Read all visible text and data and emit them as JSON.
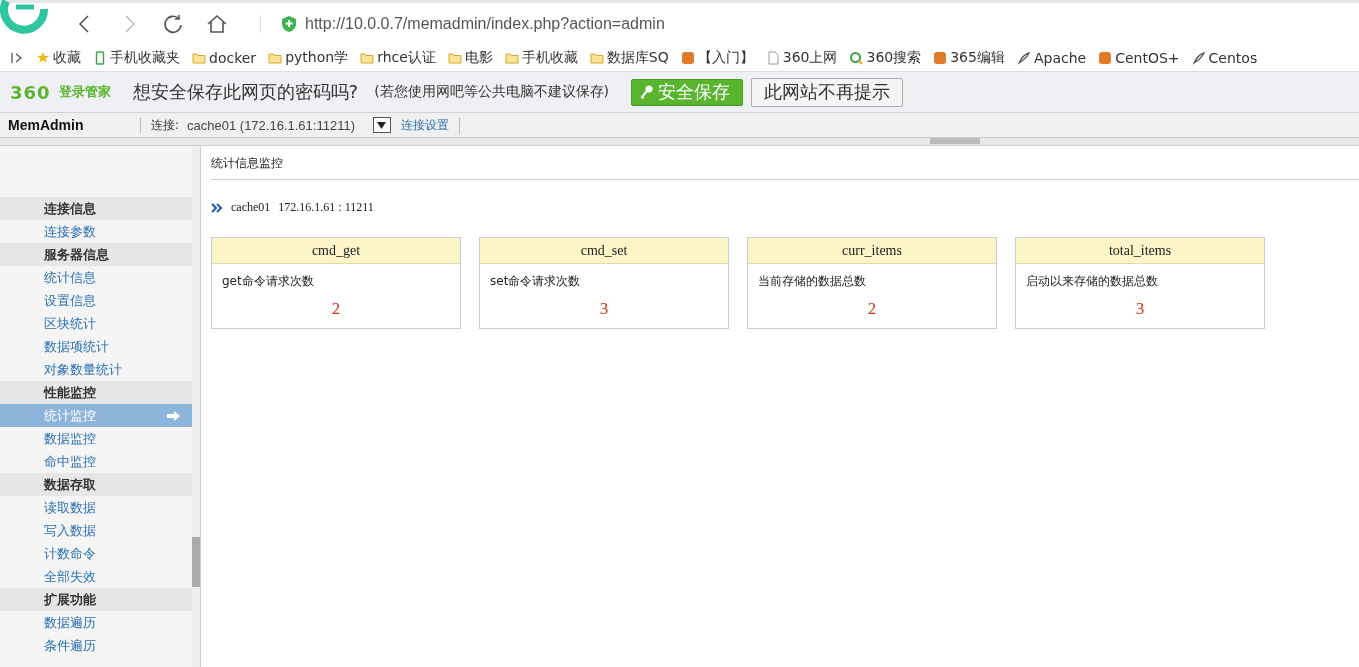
{
  "browser": {
    "url": "http://10.0.0.7/memadmin/index.php?action=admin"
  },
  "bookmarks": [
    {
      "label": "收藏",
      "kind": "star"
    },
    {
      "label": "手机收藏夹",
      "kind": "phone"
    },
    {
      "label": "docker",
      "kind": "folder"
    },
    {
      "label": "python学",
      "kind": "folder"
    },
    {
      "label": "rhce认证",
      "kind": "folder"
    },
    {
      "label": "电影",
      "kind": "folder"
    },
    {
      "label": "手机收藏",
      "kind": "folder"
    },
    {
      "label": "数据库SQ",
      "kind": "folder"
    },
    {
      "label": "【入门】",
      "kind": "site"
    },
    {
      "label": "360上网",
      "kind": "page"
    },
    {
      "label": "360搜索",
      "kind": "search"
    },
    {
      "label": "365编辑",
      "kind": "site"
    },
    {
      "label": "Apache",
      "kind": "feather"
    },
    {
      "label": "CentOS+",
      "kind": "site"
    },
    {
      "label": "Centos",
      "kind": "feather"
    }
  ],
  "password_bar": {
    "brand": "360",
    "brand_label": "登录管家",
    "question": "想安全保存此网页的密码吗?",
    "hint": "(若您使用网吧等公共电脑不建议保存)",
    "save_button": "安全保存",
    "dismiss_button": "此网站不再提示"
  },
  "app_bar": {
    "title": "MemAdmin",
    "connection_label": "连接:",
    "connection": "cache01 (172.16.1.61:11211)",
    "settings_link": "连接设置"
  },
  "sidebar": [
    {
      "title": "连接信息",
      "items": [
        {
          "label": "连接参数",
          "selected": false
        }
      ]
    },
    {
      "title": "服务器信息",
      "items": [
        {
          "label": "统计信息",
          "selected": false
        },
        {
          "label": "设置信息",
          "selected": false
        },
        {
          "label": "区块统计",
          "selected": false
        },
        {
          "label": "数据项统计",
          "selected": false
        },
        {
          "label": "对象数量统计",
          "selected": false
        }
      ]
    },
    {
      "title": "性能监控",
      "items": [
        {
          "label": "统计监控",
          "selected": true
        },
        {
          "label": "数据监控",
          "selected": false
        },
        {
          "label": "命中监控",
          "selected": false
        }
      ]
    },
    {
      "title": "数据存取",
      "items": [
        {
          "label": "读取数据",
          "selected": false
        },
        {
          "label": "写入数据",
          "selected": false
        },
        {
          "label": "计数命令",
          "selected": false
        },
        {
          "label": "全部失效",
          "selected": false
        }
      ]
    },
    {
      "title": "扩展功能",
      "items": [
        {
          "label": "数据遍历",
          "selected": false
        },
        {
          "label": "条件遍历",
          "selected": false
        }
      ]
    }
  ],
  "content": {
    "title": "统计信息监控",
    "server": "cache01",
    "address": "172.16.1.61 : 11211",
    "cards": [
      {
        "name": "cmd_get",
        "description": "get命令请求次数",
        "value": "2"
      },
      {
        "name": "cmd_set",
        "description": "set命令请求次数",
        "value": "3"
      },
      {
        "name": "curr_items",
        "description": "当前存储的数据总数",
        "value": "2"
      },
      {
        "name": "total_items",
        "description": "启动以来存储的数据总数",
        "value": "3"
      }
    ]
  }
}
